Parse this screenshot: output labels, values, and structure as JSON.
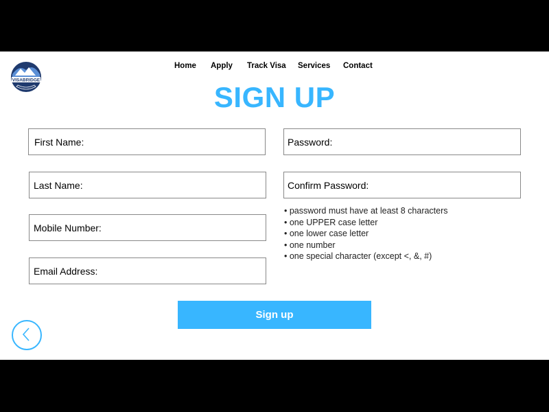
{
  "logo": {
    "text": "VISABRIDGE"
  },
  "nav": {
    "items": [
      "Home",
      "Apply",
      "Track Visa",
      "Services",
      "Contact"
    ]
  },
  "title": "SIGN UP",
  "form": {
    "first_name_label": "First Name:",
    "last_name_label": "Last Name:",
    "mobile_label": "Mobile Number:",
    "email_label": "Email Address:",
    "password_label": "Password:",
    "confirm_password_label": "Confirm Password:"
  },
  "password_rules": [
    "password must have at least 8 characters",
    "one UPPER case letter",
    "one lower case letter",
    "one number",
    "one special character (except <, &, #)"
  ],
  "signup_button_label": "Sign up",
  "icons": {
    "back": "chevron-left-icon"
  },
  "colors": {
    "accent": "#38b6ff",
    "logo_navy": "#1f3a6e"
  }
}
